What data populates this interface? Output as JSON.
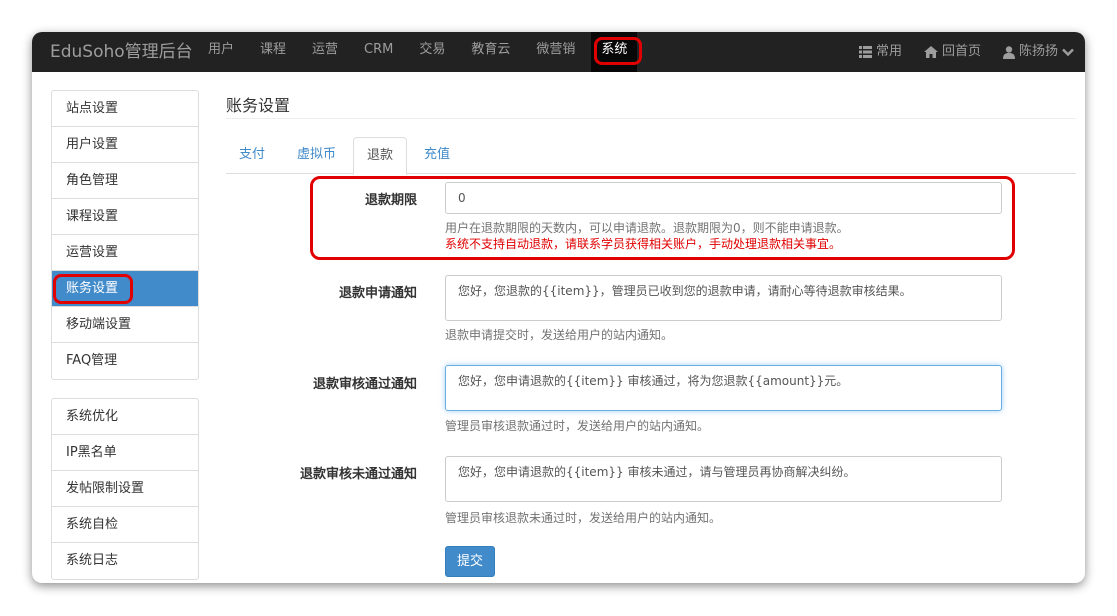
{
  "navbar": {
    "brand": "EduSoho管理后台",
    "items": [
      "用户",
      "课程",
      "运营",
      "CRM",
      "交易",
      "教育云",
      "微营销",
      "系统"
    ],
    "active_index": 7,
    "right": {
      "common": "常用",
      "home": "回首页",
      "user": "陈扬扬"
    },
    "icons": {
      "common": "list-icon",
      "home": "home-icon",
      "user": "user-icon",
      "caret": "chevron-down-icon"
    }
  },
  "sidebar": {
    "group1": [
      "站点设置",
      "用户设置",
      "角色管理",
      "课程设置",
      "运营设置",
      "账务设置",
      "移动端设置",
      "FAQ管理"
    ],
    "group1_active_index": 5,
    "group2": [
      "系统优化",
      "IP黑名单",
      "发帖限制设置",
      "系统自检",
      "系统日志"
    ]
  },
  "main": {
    "title": "账务设置",
    "tabs": [
      "支付",
      "虚拟币",
      "退款",
      "充值"
    ],
    "active_tab_index": 2,
    "form": {
      "refund_days": {
        "label": "退款期限",
        "value": "0",
        "help": "用户在退款期限的天数内，可以申请退款。退款期限为0，则不能申请退款。",
        "warning": "系统不支持自动退款，请联系学员获得相关账户，手动处理退款相关事宜。"
      },
      "apply_notice": {
        "label": "退款申请通知",
        "value": "您好，您退款的{{item}}，管理员已收到您的退款申请，请耐心等待退款审核结果。",
        "help": "退款申请提交时，发送给用户的站内通知。"
      },
      "approved_notice": {
        "label": "退款审核通过通知",
        "value": "您好，您申请退款的{{item}} 审核通过，将为您退款{{amount}}元。",
        "help": "管理员审核退款通过时，发送给用户的站内通知。"
      },
      "rejected_notice": {
        "label": "退款审核未通过通知",
        "value": "您好，您申请退款的{{item}} 审核未通过，请与管理员再协商解决纠纷。",
        "help": "管理员审核退款未通过时，发送给用户的站内通知。"
      },
      "submit": "提交"
    }
  },
  "colors": {
    "navbar": "#222222",
    "primary": "#428bca",
    "highlight": "#e00000"
  }
}
